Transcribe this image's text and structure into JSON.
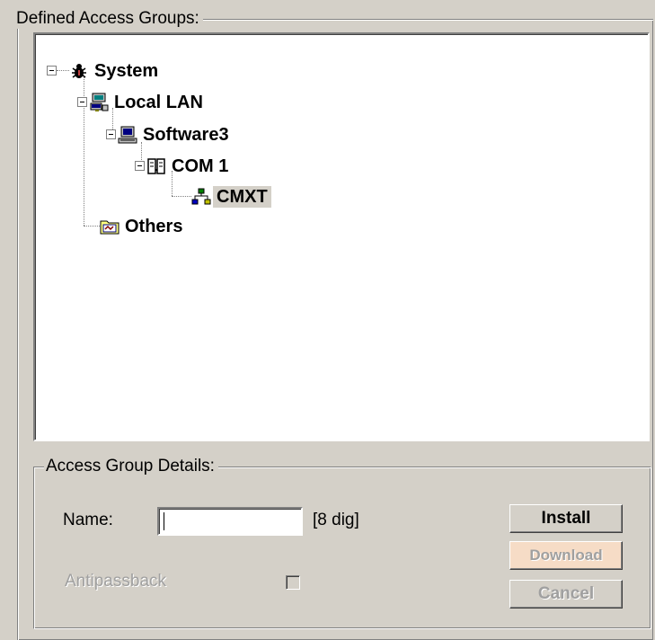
{
  "groups": {
    "defined_access_groups": "Defined Access Groups:",
    "access_group_details": "Access Group Details:"
  },
  "tree": {
    "nodes": [
      {
        "label": "System",
        "icon": "system-bug-icon",
        "expanded": true
      },
      {
        "label": "Local LAN",
        "icon": "network-icon",
        "expanded": true
      },
      {
        "label": "Software3",
        "icon": "computer-icon",
        "expanded": true
      },
      {
        "label": "COM 1",
        "icon": "com-port-icon",
        "expanded": true
      },
      {
        "label": "CMXT",
        "icon": "hierarchy-icon",
        "selected": true
      },
      {
        "label": "Others",
        "icon": "folder-icon"
      }
    ]
  },
  "details": {
    "name_label": "Name:",
    "name_value": "",
    "name_hint": "[8 dig]",
    "antipassback_label": "Antipassback",
    "antipassback_checked": false
  },
  "buttons": {
    "install": "Install",
    "download": "Download",
    "cancel": "Cancel"
  },
  "colors": {
    "window_bg": "#d4d0c8",
    "download_bg": "#f6dcc6",
    "disabled_text": "#a0a0a0"
  }
}
